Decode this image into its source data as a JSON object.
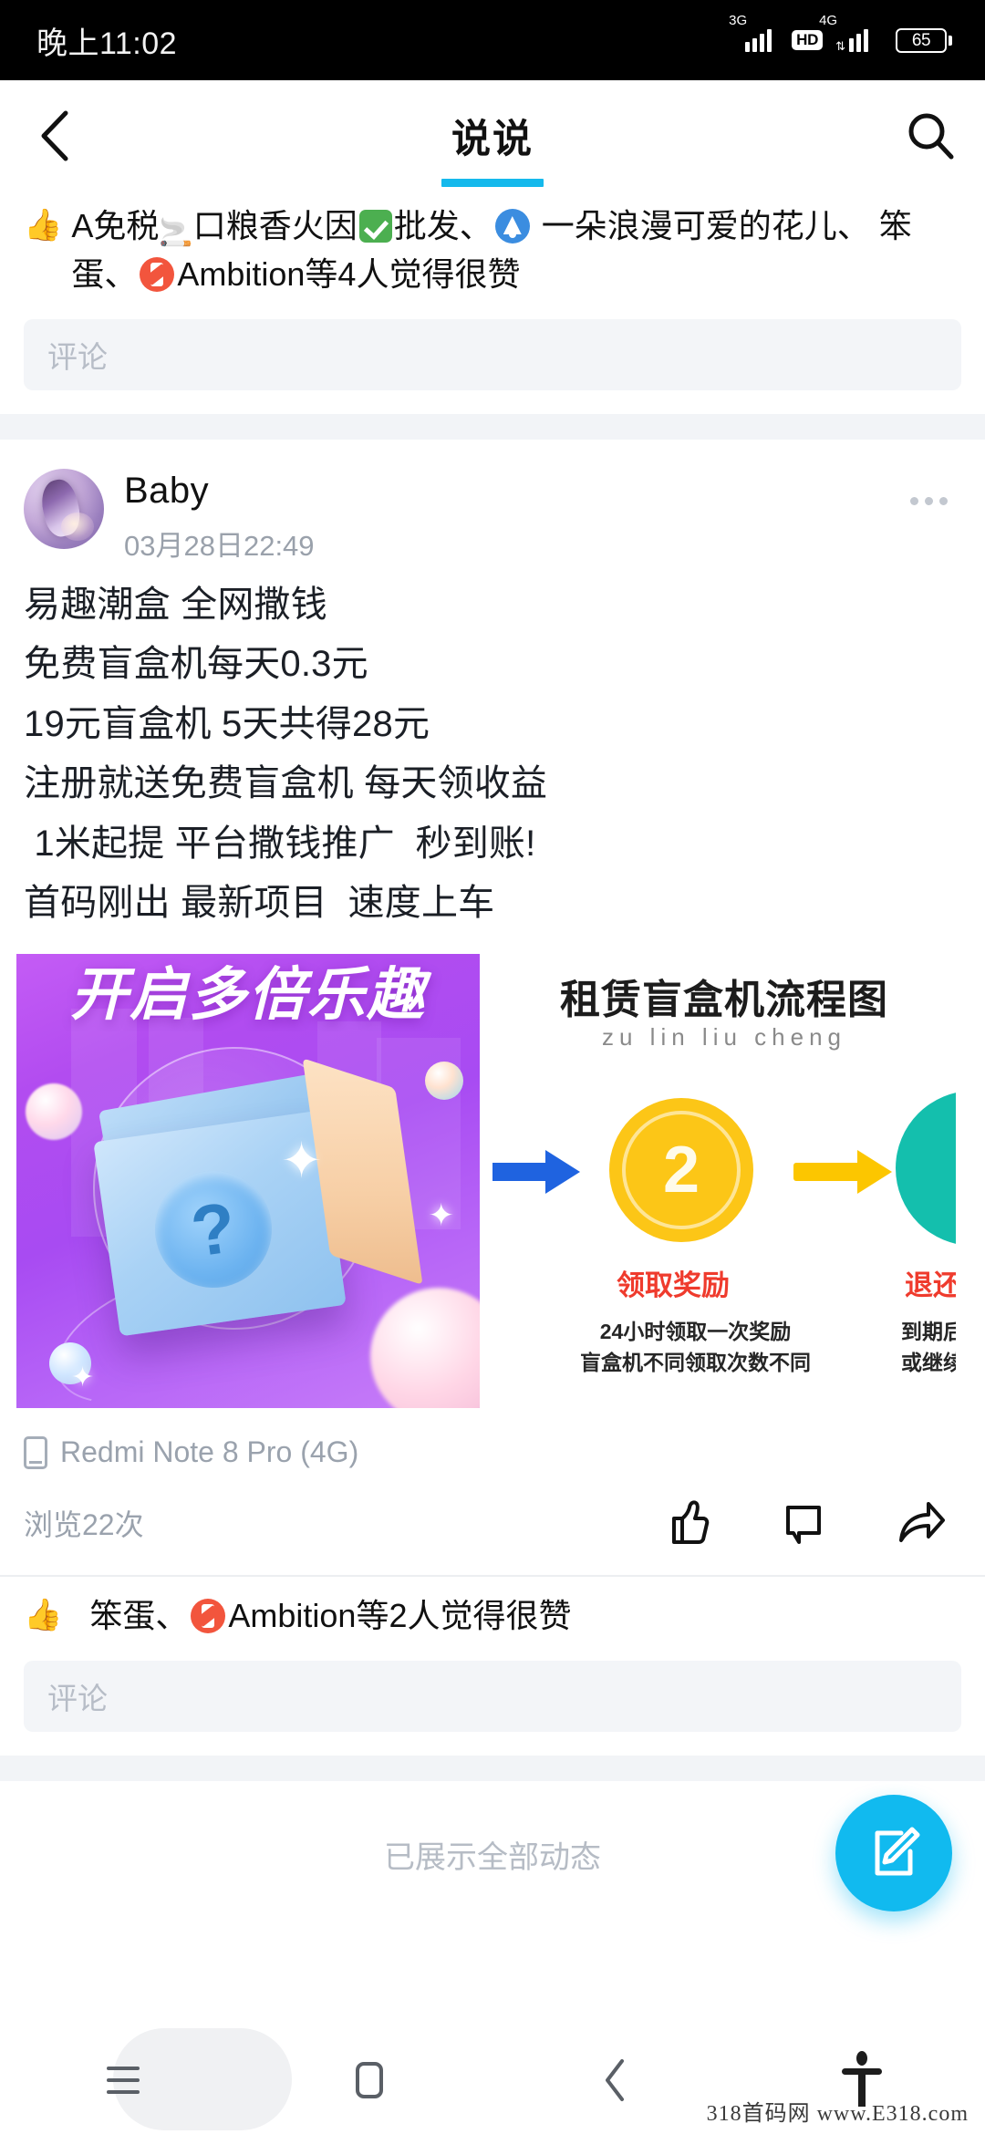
{
  "status_bar": {
    "time": "晚上11:02",
    "sim1_network": "3G",
    "hd_label": "HD",
    "sim2_network": "4G",
    "battery_percent": "65"
  },
  "app_bar": {
    "title": "说说",
    "back_icon": "chevron-left-icon",
    "search_icon": "search-icon",
    "accent_color": "#15b9ec"
  },
  "post_top": {
    "likes_prefix": "👍",
    "likes_text_line1": "A免税",
    "likes_text_line1b": "口粮香火因",
    "likes_text_line1c": "批发、",
    "likes_text_line1d": "一朵浪漫可爱的花",
    "likes_text_line2a": "儿、  笨蛋、",
    "likes_text_line2b": "Ambition等4人觉得很赞",
    "comment_placeholder": "评论"
  },
  "post": {
    "user_name": "Baby",
    "timestamp": "03月28日22:49",
    "more_icon": "more-horizontal-icon",
    "text_lines": [
      "易趣潮盒 全网撒钱",
      "免费盲盒机每天0.3元",
      "19元盲盒机 5天共得28元",
      "注册就送免费盲盒机 每天领收益",
      " 1米起提 平台撒钱推广  秒到账!",
      "首码刚出 最新项目  速度上车"
    ],
    "image_left": {
      "headline": "开启多倍乐趣",
      "box_symbol": "?"
    },
    "image_right": {
      "title": "租赁盲盒机流程图",
      "pinyin": "zu  lin  liu  cheng",
      "step_number": "2",
      "step_label": "领取奖励",
      "step_sub_line1": "24小时领取一次奖励",
      "step_sub_line2": "盲盒机不同领取次数不同",
      "next_label": "退还",
      "next_sub_line1": "到期后",
      "next_sub_line2": "或继续"
    },
    "device": "Redmi Note 8 Pro (4G)",
    "views": "浏览22次",
    "like_icon": "thumbs-up-icon",
    "comment_icon": "comment-bubble-icon",
    "share_icon": "share-arrow-icon",
    "likes_prefix": "👍",
    "likes_text_a": "笨蛋、",
    "likes_text_b": "Ambition等2人觉得很赞",
    "comment_placeholder": "评论"
  },
  "footer": {
    "end_of_feed": "已展示全部动态"
  },
  "fab": {
    "icon": "compose-edit-icon",
    "color": "#11baef"
  },
  "nav_bar": {
    "recents_icon": "recents-menu-icon",
    "home_icon": "home-square-icon",
    "back_icon": "nav-back-icon",
    "accessibility_icon": "accessibility-icon"
  },
  "watermark": {
    "text": "318首码网  www.E318.com"
  }
}
